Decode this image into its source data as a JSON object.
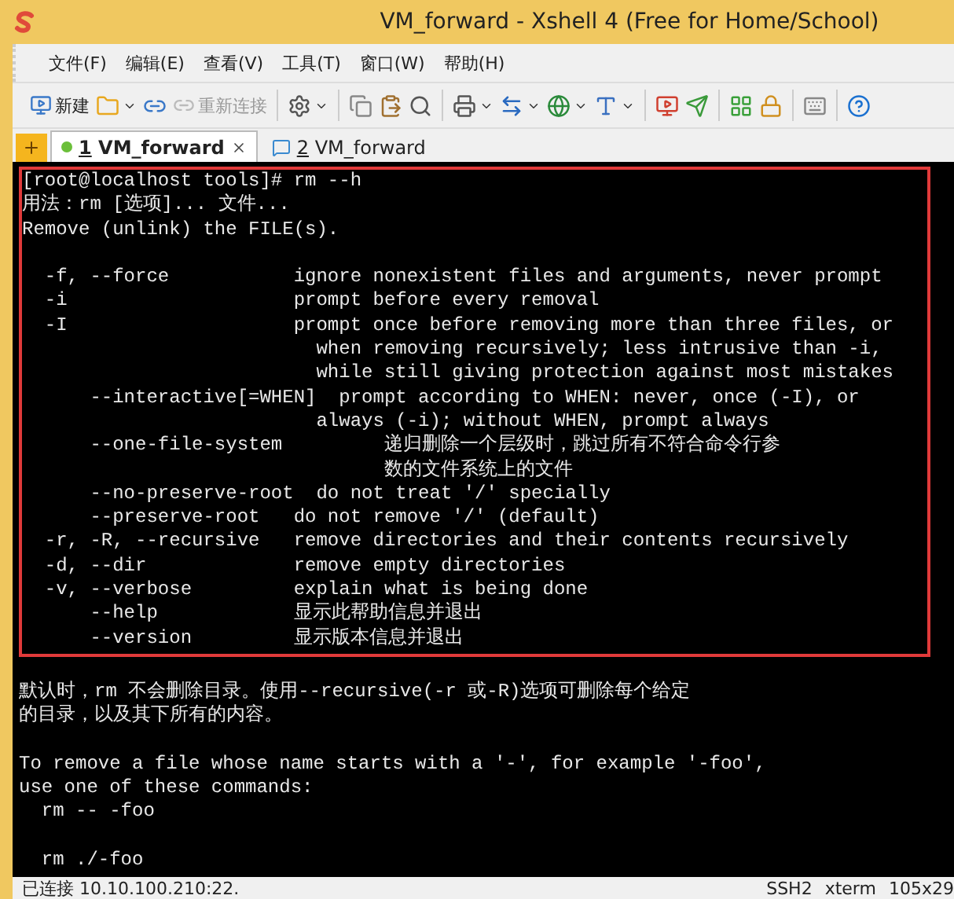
{
  "window": {
    "title": "VM_forward - Xshell 4 (Free for Home/School)"
  },
  "menu": [
    "文件(F)",
    "编辑(E)",
    "查看(V)",
    "工具(T)",
    "窗口(W)",
    "帮助(H)"
  ],
  "toolbar": [
    {
      "kind": "text",
      "label": "新建",
      "disabled": false
    },
    {
      "kind": "dropdown"
    },
    {
      "kind": "icon"
    },
    {
      "kind": "text",
      "label": "重新连接",
      "disabled": true
    },
    {
      "kind": "sep"
    },
    {
      "kind": "dropdown"
    },
    {
      "kind": "sep"
    },
    {
      "kind": "icon"
    },
    {
      "kind": "icon"
    },
    {
      "kind": "icon"
    },
    {
      "kind": "sep"
    },
    {
      "kind": "dropdown"
    },
    {
      "kind": "dropdown"
    },
    {
      "kind": "dropdown"
    },
    {
      "kind": "dropdown"
    },
    {
      "kind": "sep"
    },
    {
      "kind": "icon"
    },
    {
      "kind": "icon"
    },
    {
      "kind": "sep"
    },
    {
      "kind": "icon"
    },
    {
      "kind": "icon"
    },
    {
      "kind": "sep"
    },
    {
      "kind": "icon"
    },
    {
      "kind": "sep"
    },
    {
      "kind": "icon"
    }
  ],
  "tabs": [
    {
      "number": "1",
      "label": "VM_forward",
      "selected": true
    },
    {
      "number": "2",
      "label": "VM_forward",
      "selected": false
    }
  ],
  "terminal": {
    "highlighted": [
      [
        "[root@localhost tools]# rm --h",
        "用法：rm [选项]... 文件...",
        "Remove (unlink) the FILE(s)."
      ],
      [
        "  -f, --force           ignore nonexistent files and arguments, never prompt",
        "  -i                    prompt before every removal",
        "  -I                    prompt once before removing more than three files, or",
        "                          when removing recursively; less intrusive than -i,",
        "                          while still giving protection against most mistakes",
        "      --interactive[=WHEN]  prompt according to WHEN: never, once (-I), or",
        "                          always (-i); without WHEN, prompt always",
        "      --one-file-system         递归删除一个层级时，跳过所有不符合命令行参",
        "                                数的文件系统上的文件",
        "      --no-preserve-root  do not treat '/' specially",
        "      --preserve-root   do not remove '/' (default)",
        "  -r, -R, --recursive   remove directories and their contents recursively",
        "  -d, --dir             remove empty directories",
        "  -v, --verbose         explain what is being done",
        "      --help            显示此帮助信息并退出",
        "      --version         显示版本信息并退出"
      ]
    ],
    "after": [
      [
        "默认时，rm 不会删除目录。使用--recursive(-r 或-R)选项可删除每个给定",
        "的目录，以及其下所有的内容。"
      ],
      [
        "To remove a file whose name starts with a '-', for example '-foo',",
        "use one of these commands:",
        "  rm -- -foo"
      ],
      [
        "  rm ./-foo"
      ]
    ]
  },
  "status_bar": {
    "connection": "已连接 10.10.100.210:22.",
    "fields": [
      "SSH2",
      "xterm",
      "105x29"
    ]
  }
}
